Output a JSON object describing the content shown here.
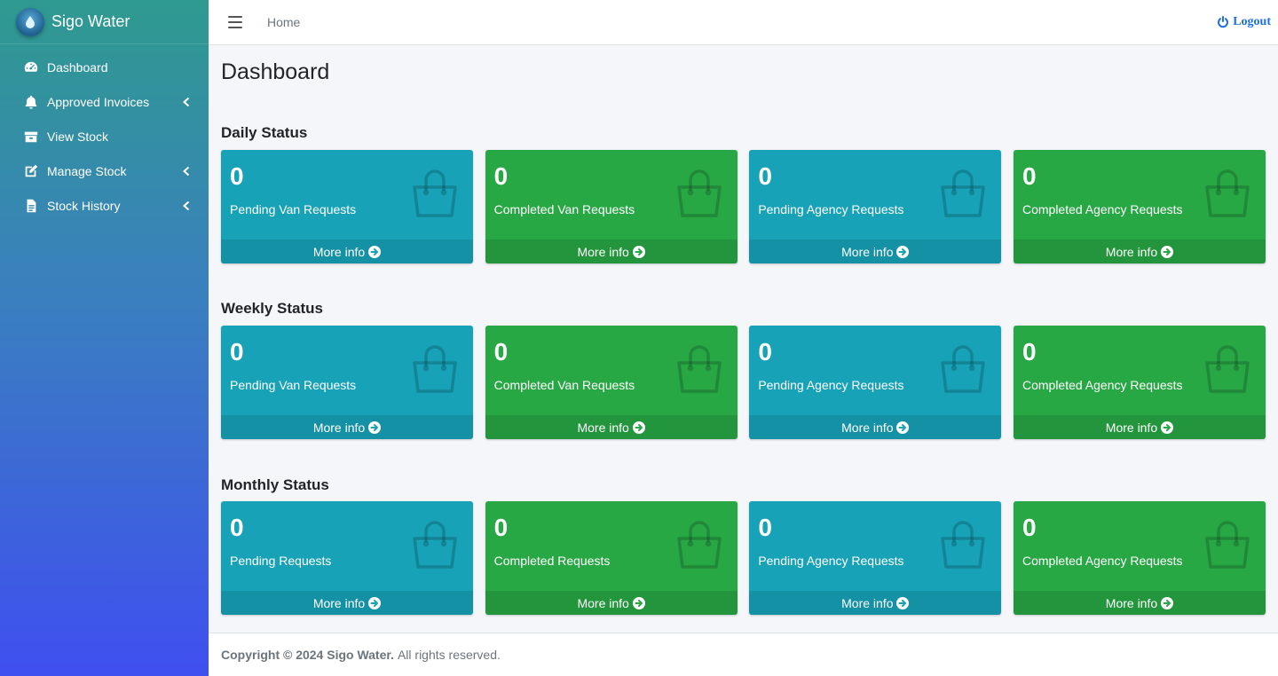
{
  "brand": {
    "name": "Sigo Water",
    "logo_icon": "water-drop-icon"
  },
  "sidebar": {
    "items": [
      {
        "label": "Dashboard",
        "icon": "tachometer-icon",
        "has_caret": false
      },
      {
        "label": "Approved Invoices",
        "icon": "bell-icon",
        "has_caret": true
      },
      {
        "label": "View Stock",
        "icon": "box-icon",
        "has_caret": false
      },
      {
        "label": "Manage Stock",
        "icon": "edit-icon",
        "has_caret": true
      },
      {
        "label": "Stock History",
        "icon": "document-icon",
        "has_caret": true
      }
    ]
  },
  "topbar": {
    "home": "Home",
    "logout": "Logout"
  },
  "page": {
    "title": "Dashboard"
  },
  "sections": [
    {
      "title": "Daily Status",
      "boxes": [
        {
          "count": "0",
          "label": "Pending Van Requests",
          "more": "More info",
          "color": "#17a2b8"
        },
        {
          "count": "0",
          "label": "Completed Van Requests",
          "more": "More info",
          "color": "#28a745"
        },
        {
          "count": "0",
          "label": "Pending Agency Requests",
          "more": "More info",
          "color": "#17a2b8"
        },
        {
          "count": "0",
          "label": "Completed Agency Requests",
          "more": "More info",
          "color": "#28a745"
        }
      ]
    },
    {
      "title": "Weekly Status",
      "boxes": [
        {
          "count": "0",
          "label": "Pending Van Requests",
          "more": "More info",
          "color": "#17a2b8"
        },
        {
          "count": "0",
          "label": "Completed Van Requests",
          "more": "More info",
          "color": "#28a745"
        },
        {
          "count": "0",
          "label": "Pending Agency Requests",
          "more": "More info",
          "color": "#17a2b8"
        },
        {
          "count": "0",
          "label": "Completed Agency Requests",
          "more": "More info",
          "color": "#28a745"
        }
      ]
    },
    {
      "title": "Monthly Status",
      "boxes": [
        {
          "count": "0",
          "label": "Pending Requests",
          "more": "More info",
          "color": "#17a2b8"
        },
        {
          "count": "0",
          "label": "Completed Requests",
          "more": "More info",
          "color": "#28a745"
        },
        {
          "count": "0",
          "label": "Pending Agency Requests",
          "more": "More info",
          "color": "#17a2b8"
        },
        {
          "count": "0",
          "label": "Completed Agency Requests",
          "more": "More info",
          "color": "#28a745"
        }
      ]
    }
  ],
  "footer": {
    "copyright": "Copyright © 2024 Sigo Water.",
    "rights": "All rights reserved."
  }
}
